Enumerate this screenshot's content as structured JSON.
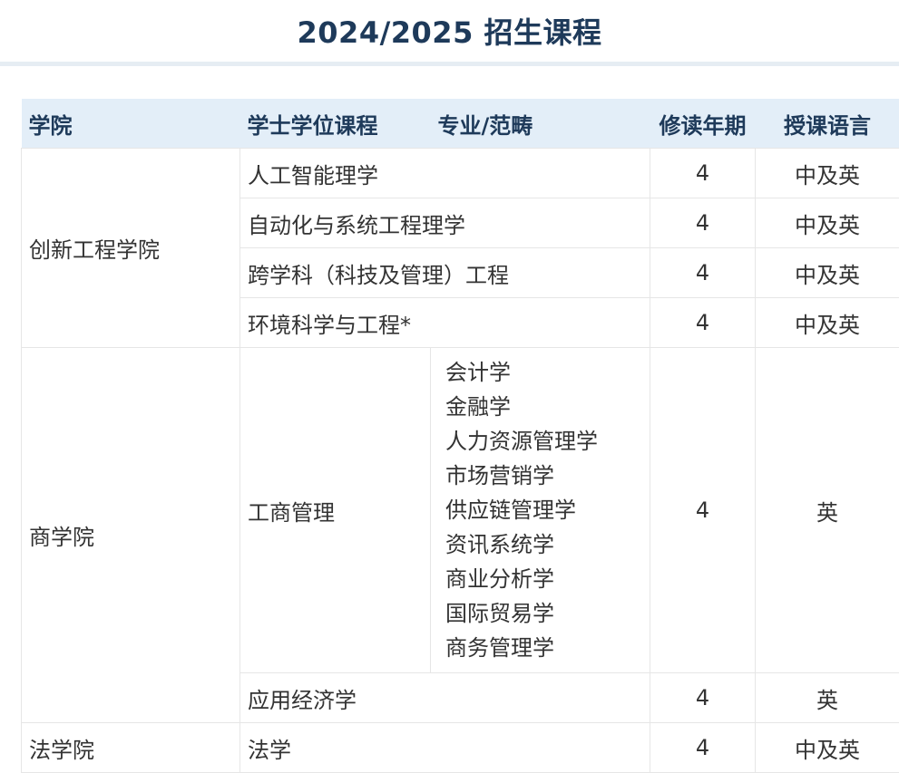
{
  "page": {
    "title": "2024/2025 招生课程"
  },
  "table": {
    "headers": {
      "faculty": "学院",
      "program": "学士学位课程",
      "specialization": "专业/范畴",
      "duration": "修读年期",
      "language": "授课语言"
    },
    "groups": [
      {
        "faculty": "创新工程学院",
        "rows": [
          {
            "program": "人工智能理学",
            "duration": "4",
            "language": "中及英"
          },
          {
            "program": "自动化与系统工程理学",
            "duration": "4",
            "language": "中及英"
          },
          {
            "program": "跨学科（科技及管理）工程",
            "duration": "4",
            "language": "中及英"
          },
          {
            "program": "环境科学与工程*",
            "duration": "4",
            "language": "中及英"
          }
        ]
      },
      {
        "faculty": "商学院",
        "rows": [
          {
            "program": "工商管理",
            "specializations": [
              "会计学",
              "金融学",
              "人力资源管理学",
              "市场营销学",
              "供应链管理学",
              "资讯系统学",
              "商业分析学",
              "国际贸易学",
              "商务管理学"
            ],
            "duration": "4",
            "language": "英"
          },
          {
            "program": "应用经济学",
            "duration": "4",
            "language": "英"
          }
        ]
      },
      {
        "faculty": "法学院",
        "rows": [
          {
            "program": "法学",
            "duration": "4",
            "language": "中及英"
          }
        ]
      }
    ]
  }
}
